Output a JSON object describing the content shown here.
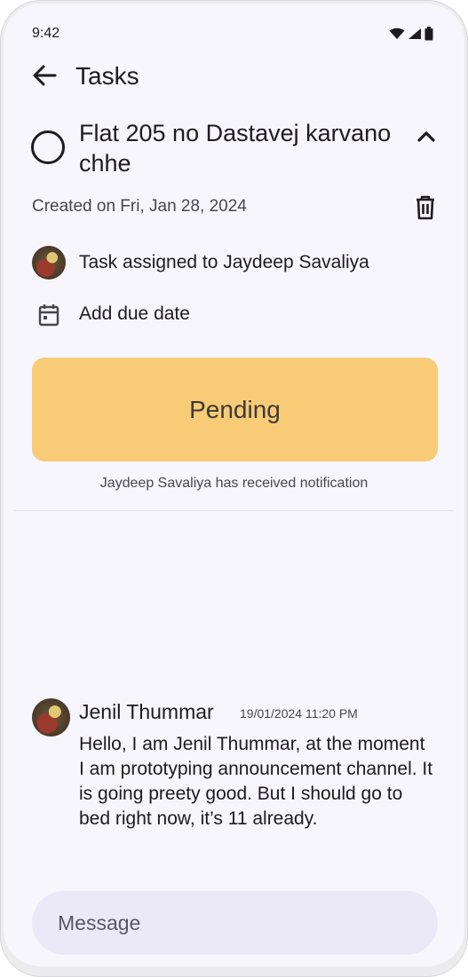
{
  "status_bar": {
    "time": "9:42"
  },
  "header": {
    "title": "Tasks"
  },
  "task": {
    "title": "Flat 205 no Dastavej karvano chhe",
    "created": "Created on Fri, Jan 28, 2024",
    "assigned": "Task assigned to Jaydeep Savaliya",
    "due_date_label": "Add due date",
    "status_label": "Pending",
    "status_color": "#f8cb76",
    "notification": "Jaydeep Savaliya has received notification"
  },
  "message": {
    "author": "Jenil Thummar",
    "timestamp": "19/01/2024 11:20 PM",
    "text": "Hello, I am Jenil Thummar, at the moment I am prototyping announcement channel. It is going preety good. But I should go to bed right now, it’s 11 already."
  },
  "composer": {
    "placeholder": "Message"
  }
}
